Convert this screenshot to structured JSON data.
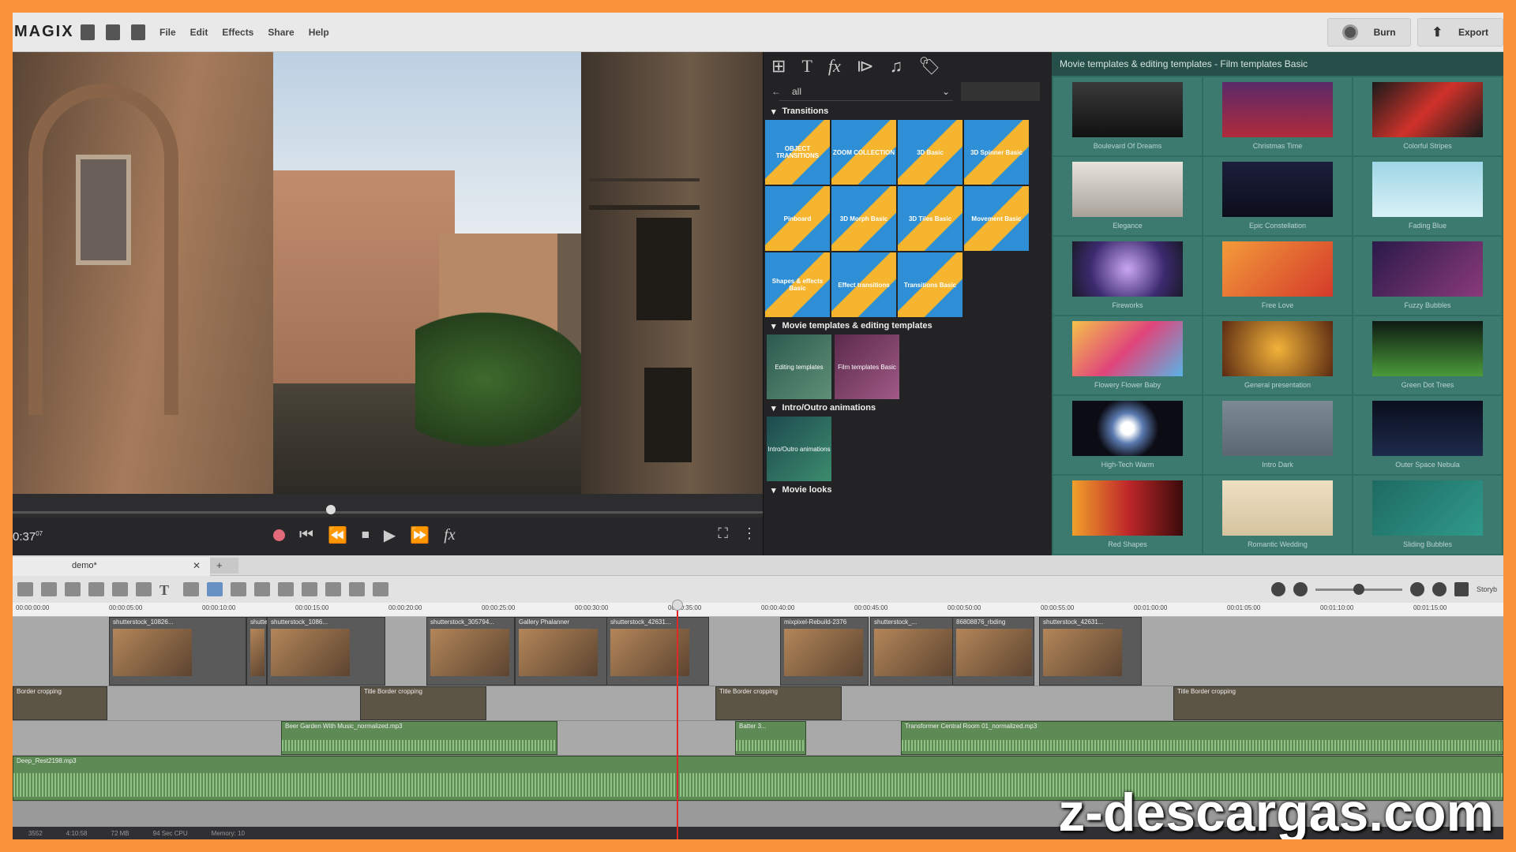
{
  "app": {
    "logo": "MAGIX",
    "menu": [
      "File",
      "Edit",
      "Effects",
      "Share",
      "Help"
    ],
    "burn_label": "Burn",
    "export_label": "Export"
  },
  "preview": {
    "timecode": "0:37",
    "timecode_frames": "07"
  },
  "pool": {
    "filter": "all",
    "sections": {
      "transitions": "Transitions",
      "movie_templates": "Movie templates & editing templates",
      "intro_outro": "Intro/Outro animations",
      "movie_looks": "Movie looks"
    },
    "transition_tiles": [
      "OBJECT TRANSITIONS",
      "ZOOM COLLECTION",
      "3D Basic",
      "3D Spinner Basic",
      "Pinboard",
      "3D Morph Basic",
      "3D Tiles Basic",
      "Movement Basic",
      "Shapes & effects Basic",
      "Effect transitions",
      "Transitions Basic"
    ],
    "template_tiles": [
      "Editing templates",
      "Film templates Basic"
    ],
    "intro_tiles": [
      "Intro/Outro animations"
    ]
  },
  "templates": {
    "title": "Movie templates & editing templates - Film templates Basic",
    "items": [
      "Boulevard Of Dreams",
      "Christmas Time",
      "Colorful Stripes",
      "Elegance",
      "Epic Constellation",
      "Fading Blue",
      "Fireworks",
      "Free Love",
      "Fuzzy Bubbles",
      "Flowery Flower Baby",
      "General presentation",
      "Green Dot Trees",
      "High-Tech Warm",
      "Intro Dark",
      "Outer Space Nebula",
      "Red Shapes",
      "Romantic Wedding",
      "Sliding Bubbles"
    ]
  },
  "timeline": {
    "tab_name": "demo*",
    "ruler": [
      "00:00:00:00",
      "00:00:05:00",
      "00:00:10:00",
      "00:00:15:00",
      "00:00:20:00",
      "00:00:25:00",
      "00:00:30:00",
      "00:00:35:00",
      "00:00:40:00",
      "00:00:45:00",
      "00:00:50:00",
      "00:00:55:00",
      "00:01:00:00",
      "00:01:05:00",
      "00:01:10:00",
      "00:01:15:00"
    ],
    "video_clips": [
      "shutterstock_10826...",
      "shutterstock_b...",
      "shutterstock_1086...",
      "shutterstock_305794...",
      "Gallery Phalanner",
      "shutterstock_42631...",
      "mixpixel-Rebuild-2376",
      "shutterstock_...",
      "86808876_rbding",
      "shutterstock_42631..."
    ],
    "title_clips": [
      "Border cropping",
      "Title Border cropping",
      "Title Border cropping",
      "Title Border cropping"
    ],
    "audio_clips": [
      "Beer Garden With Music_normalized.mp3",
      "Batter 3...",
      "Transformer Central Room 01_normalized.mp3"
    ],
    "music_clip": "Deep_Rest2198.mp3",
    "zoom_label": "Storyb"
  },
  "status": [
    "3552",
    "4:10:58",
    "72 MB",
    "94 Sec CPU",
    "Memory: 10"
  ],
  "watermark": "z-descargas.com"
}
